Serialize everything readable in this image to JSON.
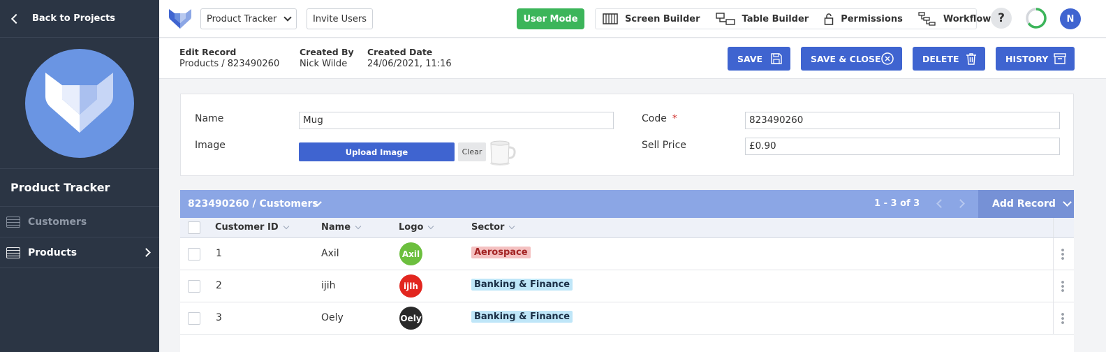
{
  "sidebar": {
    "back_label": "Back to Projects",
    "project_title": "Product Tracker",
    "items": [
      {
        "label": "Customers"
      },
      {
        "label": "Products"
      }
    ]
  },
  "topbar": {
    "project_select": "Product Tracker",
    "invite_label": "Invite Users",
    "user_mode_label": "User Mode",
    "tools": {
      "screen_builder": "Screen Builder",
      "table_builder": "Table Builder",
      "permissions": "Permissions",
      "workflows": "Workflows"
    },
    "help_label": "?",
    "progress_fraction": 0.65,
    "avatar_initial": "N"
  },
  "record": {
    "edit_label": "Edit Record",
    "edit_value": "Products / 823490260",
    "created_by_label": "Created By",
    "created_by_value": "Nick Wilde",
    "created_date_label": "Created Date",
    "created_date_value": "24/06/2021, 11:16",
    "buttons": {
      "save": "SAVE",
      "save_close": "SAVE & CLOSE",
      "delete": "DELETE",
      "history": "HISTORY"
    }
  },
  "form": {
    "name_label": "Name",
    "name_value": "Mug",
    "image_label": "Image",
    "upload_label": "Upload Image",
    "clear_label": "Clear",
    "code_label": "Code",
    "code_required": "*",
    "code_value": "823490260",
    "sell_price_label": "Sell Price",
    "sell_price_value": "£0.90"
  },
  "table": {
    "title": "823490260 / Customers",
    "pagination": "1 - 3 of 3",
    "add_record_label": "Add Record",
    "columns": [
      "Customer ID",
      "Name",
      "Logo",
      "Sector"
    ],
    "rows": [
      {
        "id": "1",
        "name": "Axil",
        "logo_text": "Axil",
        "logo_color": "#6cbf3e",
        "sector": "Aerospace",
        "sector_bg": "#f4c1c1",
        "sector_fg": "#a32424"
      },
      {
        "id": "2",
        "name": "ijih",
        "logo_text": "ijlh",
        "logo_color": "#e2261f",
        "sector": "Banking & Finance",
        "sector_bg": "#bfe6f8",
        "sector_fg": "#1b2f46"
      },
      {
        "id": "3",
        "name": "Oely",
        "logo_text": "Oely",
        "logo_color": "#2a2a2a",
        "sector": "Banking & Finance",
        "sector_bg": "#bfe6f8",
        "sector_fg": "#1b2f46"
      }
    ]
  },
  "colors": {
    "sidebar_bg": "#2b3544",
    "primary": "#3f64d0",
    "green": "#3cb55a",
    "table_header": "#8ba6e5"
  }
}
